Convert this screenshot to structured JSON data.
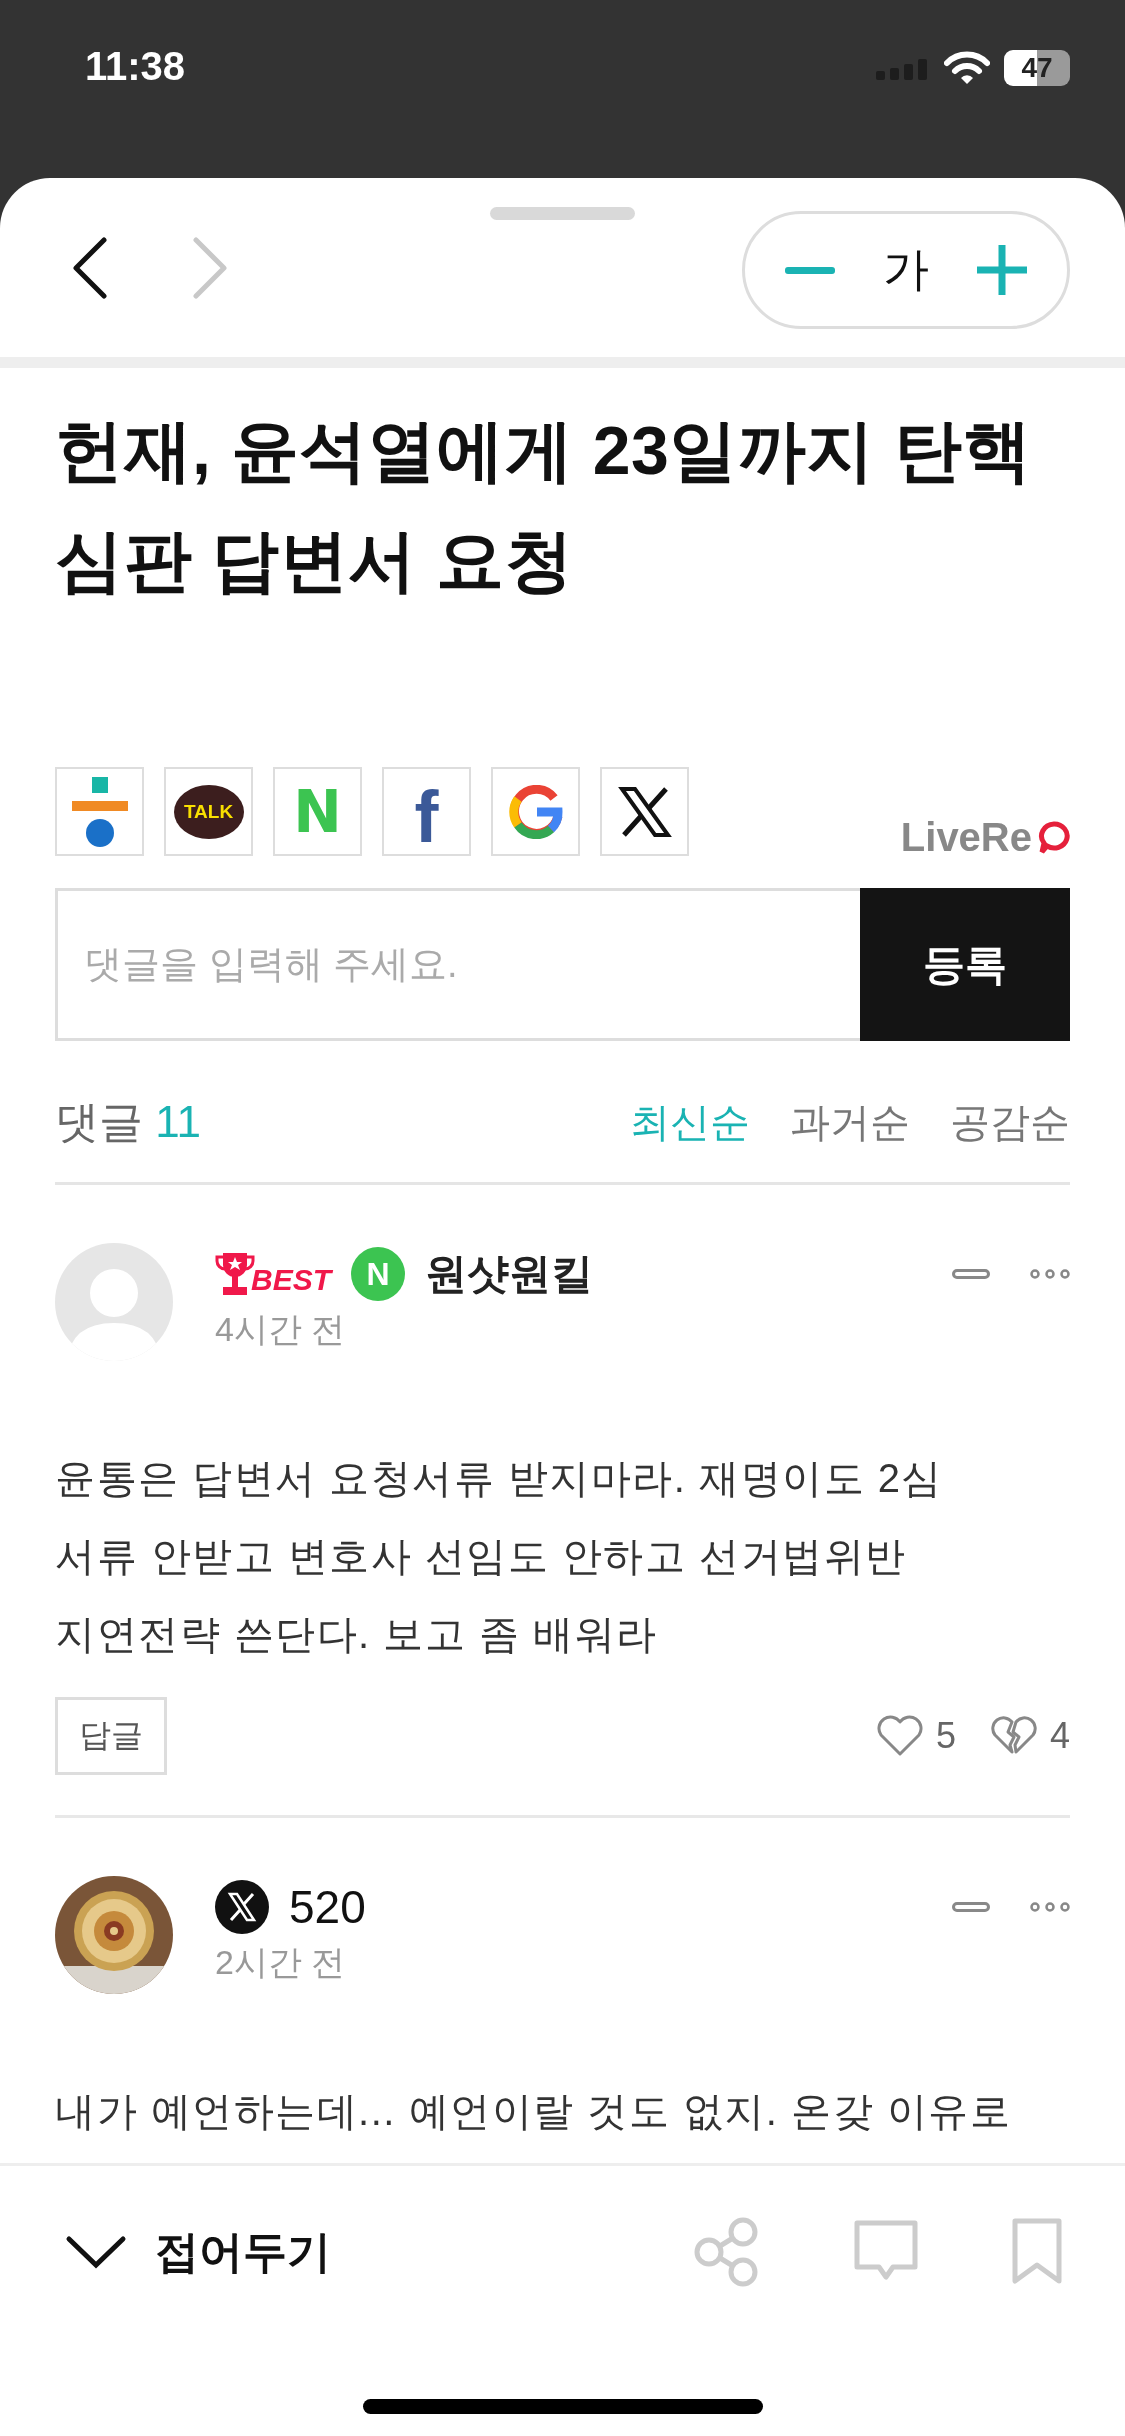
{
  "status_bar": {
    "time": "11:38",
    "battery": "47"
  },
  "toolbar": {
    "back": {
      "disabled": false
    },
    "forward": {
      "disabled": true
    },
    "font_size_label": "가"
  },
  "headline": "헌재, 윤석열에게 23일까지 탄핵심판 답변서 요청",
  "share_buttons": [
    {
      "kind": "daum"
    },
    {
      "kind": "kakao",
      "label": "TALK"
    },
    {
      "kind": "naver",
      "label": "N"
    },
    {
      "kind": "facebook",
      "label": "f"
    },
    {
      "kind": "google"
    },
    {
      "kind": "x"
    }
  ],
  "brand": "LiveRe",
  "comment_input": {
    "placeholder": "댓글을 입력해 주세요.",
    "submit": "등록"
  },
  "comments_header": {
    "label": "댓글",
    "count": "11"
  },
  "sort_options": [
    {
      "label": "최신순",
      "selected": true
    },
    {
      "label": "과거순",
      "selected": false
    },
    {
      "label": "공감순",
      "selected": false
    }
  ],
  "comments": [
    {
      "best": true,
      "badge": "BEST",
      "platform": {
        "kind": "naver",
        "label": "N"
      },
      "avatar": {
        "kind": "default"
      },
      "author": "원샷원킬",
      "time": "4시간 전",
      "lines": [
        "윤통은 답변서 요청서류 받지마라. 재명이도 2심",
        "서류 안받고 변호사 선임도 안하고 선거법위반",
        "지연전략 쓴단다. 보고 좀 배워라"
      ],
      "reply": "답글",
      "likes": "5",
      "dislikes": "4"
    },
    {
      "best": false,
      "platform": {
        "kind": "x"
      },
      "avatar": {
        "kind": "picture"
      },
      "author": "520",
      "time": "2시간 전",
      "lines": [
        "내가 예언하는데... 예언이랄 것도 없지. 온갖 이유로"
      ]
    }
  ],
  "bottom_bar": {
    "collapse": "접어두기"
  }
}
